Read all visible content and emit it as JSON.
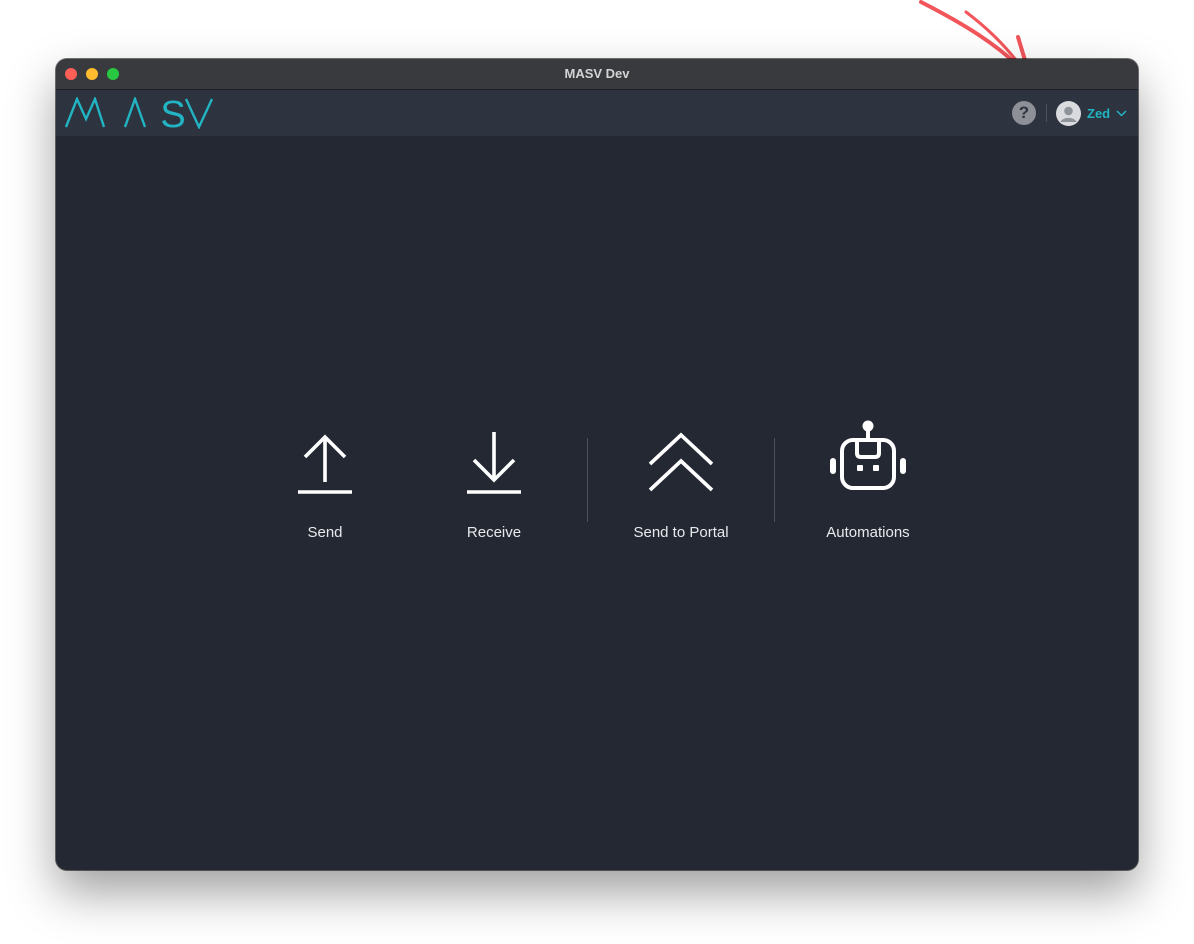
{
  "window": {
    "title": "MASV Dev"
  },
  "header": {
    "logo_text": "MASV",
    "help_label": "?",
    "user": {
      "name": "Zed"
    }
  },
  "actions": [
    {
      "label": "Send",
      "icon": "upload-arrow-icon"
    },
    {
      "label": "Receive",
      "icon": "download-arrow-icon"
    },
    {
      "label": "Send to Portal",
      "icon": "double-chevron-up-icon"
    },
    {
      "label": "Automations",
      "icon": "robot-icon"
    }
  ],
  "colors": {
    "accent": "#22b4c2",
    "annotation": "#f2555a",
    "background": "#232833",
    "header": "#2d3440"
  }
}
